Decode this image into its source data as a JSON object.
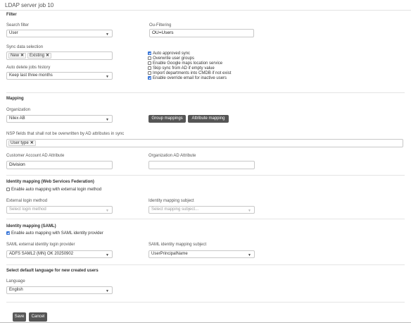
{
  "window": {
    "title": "LDAP server job 10"
  },
  "filter": {
    "section_title": "Filter",
    "search_filter_label": "Search filter",
    "search_filter_value": "User",
    "ou_filtering_label": "Ou-Filtering",
    "ou_filtering_value": "OU=Users",
    "sync_data_label": "Sync data selection",
    "sync_tags": [
      "New",
      "Existing"
    ],
    "auto_delete_label": "Auto delete jobs history",
    "auto_delete_value": "Keep last three months",
    "checkboxes": [
      {
        "label": "Auto approved sync",
        "checked": true
      },
      {
        "label": "Overwrite user groups",
        "checked": false
      },
      {
        "label": "Enable Google maps location service",
        "checked": false
      },
      {
        "label": "Skip sync from AD if empty value",
        "checked": false
      },
      {
        "label": "Import departments into CMDB if not exist",
        "checked": false
      },
      {
        "label": "Enable override email for inactive users",
        "checked": true
      }
    ]
  },
  "mapping": {
    "section_title": "Mapping",
    "organization_label": "Organization",
    "organization_value": "Nilex AB",
    "group_mappings_label": "Group mappings",
    "attribute_mapping_label": "Attribute mapping",
    "nsp_fields_label": "NSP fields that shall not be overwritten by AD attributes in sync",
    "nsp_tags": [
      "User type"
    ],
    "customer_account_label": "Customer Account AD Attribute",
    "customer_account_value": "Division",
    "organization_ad_label": "Organization AD Attribute",
    "organization_ad_value": ""
  },
  "wsfed": {
    "section_title": "Identity mapping (Web Services Federation)",
    "enable_label": "Enable auto mapping with external login method",
    "enable_checked": false,
    "external_login_label": "External login method",
    "external_login_placeholder": "Select login method",
    "subject_label": "Identity mapping subject",
    "subject_placeholder": "Select mapping subject..."
  },
  "saml": {
    "section_title": "Identity mapping (SAML)",
    "enable_label": "Enable auto mapping with SAML identity provider",
    "enable_checked": true,
    "provider_label": "SAML external identity login provider",
    "provider_value": "ADFS SAML2 (MN) OK 20250902",
    "subject_label": "SAML identity mapping subject",
    "subject_value": "UserPrincipalName"
  },
  "language": {
    "section_title": "Select default language for new created users",
    "label": "Language",
    "value": "English"
  },
  "footer": {
    "save_label": "Save",
    "cancel_label": "Cancel"
  },
  "colors": {
    "checkbox_accent": "#2f6fd6",
    "button_dark": "#555555",
    "button_save": "#5a5a5a"
  }
}
